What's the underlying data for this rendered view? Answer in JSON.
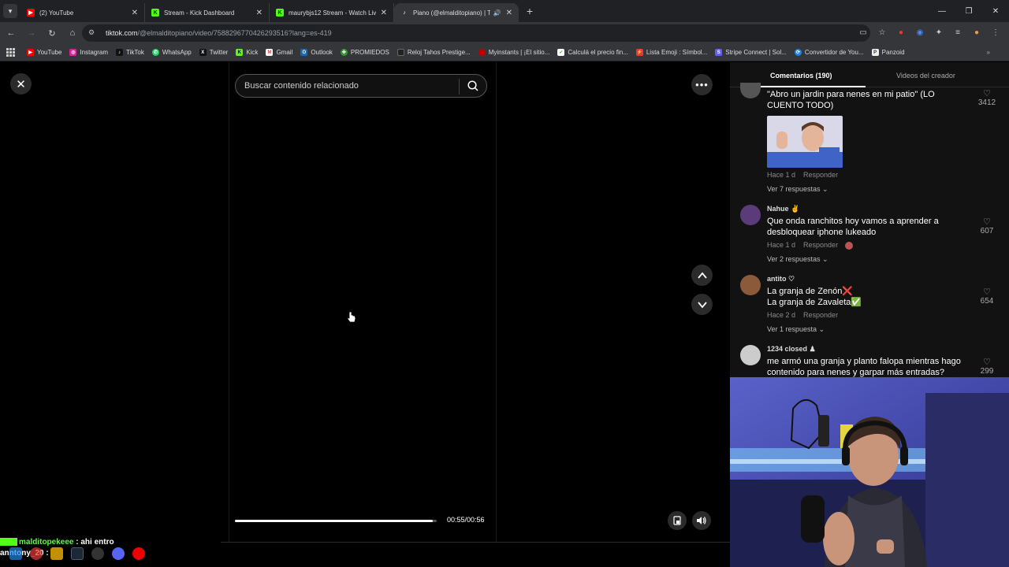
{
  "tabs": [
    {
      "title": "(2) YouTube",
      "favicon": "youtube-icon",
      "color": "#ff0000",
      "active": false
    },
    {
      "title": "Stream - Kick Dashboard",
      "favicon": "kick-icon",
      "color": "#53fc18",
      "active": false
    },
    {
      "title": "maurybjs12 Stream - Watch Liv",
      "favicon": "kick-icon",
      "color": "#53fc18",
      "active": false
    },
    {
      "title": "Piano (@elmalditopiano) | T",
      "favicon": "tiktok-icon",
      "color": "#ffffff",
      "active": true
    }
  ],
  "address": {
    "host": "tiktok.com",
    "path": "/@elmalditopiano/video/7588296770426293516?lang=es-419"
  },
  "bookmarks": [
    {
      "label": "YouTube",
      "icon": "youtube-icon",
      "color": "#ff0000"
    },
    {
      "label": "Instagram",
      "icon": "instagram-icon",
      "color": "#d6249f"
    },
    {
      "label": "TikTok",
      "icon": "tiktok-icon",
      "color": "#111111"
    },
    {
      "label": "WhatsApp",
      "icon": "whatsapp-icon",
      "color": "#25d366"
    },
    {
      "label": "Twitter",
      "icon": "x-icon",
      "color": "#111111"
    },
    {
      "label": "Kick",
      "icon": "kick-icon",
      "color": "#53fc18"
    },
    {
      "label": "Gmail",
      "icon": "gmail-icon",
      "color": "#ea4335"
    },
    {
      "label": "Outlook",
      "icon": "outlook-icon",
      "color": "#0f6cbd"
    },
    {
      "label": "PROMIEDOS",
      "icon": "promiedos-icon",
      "color": "#2e9b2e"
    },
    {
      "label": "Reloj Tahos Prestige...",
      "icon": "reloj-icon",
      "color": "#222222"
    },
    {
      "label": "Myinstants | ¡El sitio...",
      "icon": "myinstants-icon",
      "color": "#c00000"
    },
    {
      "label": "Calculá el precio fin...",
      "icon": "calculator-icon",
      "color": "#2e9b2e"
    },
    {
      "label": "Lista Emoji : Símbol...",
      "icon": "emoji-icon",
      "color": "#e53935"
    },
    {
      "label": "Stripe Connect | Sol...",
      "icon": "stripe-icon",
      "color": "#635bff"
    },
    {
      "label": "Convertidor de You...",
      "icon": "converter-icon",
      "color": "#1e88e5"
    },
    {
      "label": "Panzoid",
      "icon": "panzoid-icon",
      "color": "#eeeeee"
    }
  ],
  "search": {
    "placeholder": "Buscar contenido relacionado"
  },
  "video": {
    "time": "00:55/00:56",
    "progress": 0.982
  },
  "panel": {
    "tab_comments": "Comentarios (190)",
    "tab_creator": "Videos del creador"
  },
  "comments": [
    {
      "user": "",
      "text": "\"Abro un jardin para nenes en mi patio\" (LO CUENTO TODO)",
      "time": "Hace 1 d",
      "reply": "Responder",
      "replies": "Ver 7 respuestas",
      "likes": "3412",
      "avatar": "#555555"
    },
    {
      "user": "Nahue",
      "badge": "✌",
      "text": "Que onda ranchitos hoy vamos a aprender a desbloquear iphone lukeado",
      "time": "Hace 1 d",
      "reply": "Responder",
      "replies": "Ver 2 respuestas",
      "likes": "607",
      "avatar": "#5b3b7a"
    },
    {
      "user": "antito",
      "badge": "♡",
      "text": "La granja de Zenón❌\nLa granja de Zavaleta✅",
      "time": "Hace 2 d",
      "reply": "Responder",
      "replies": "Ver 1 respuesta",
      "likes": "654",
      "avatar": "#8a5a3a"
    },
    {
      "user": "1234 closed",
      "badge": "♟",
      "text": "me armó una granja y planto falopa mientras hago contenido para nenes y garpar más entradas?",
      "time": "",
      "reply": "",
      "replies": "",
      "likes": "299",
      "avatar": "#cccccc"
    }
  ],
  "chat": [
    {
      "user": "malditopekeee",
      "message": "ahi entro"
    },
    {
      "user": "anntony_20",
      "message": ""
    }
  ]
}
